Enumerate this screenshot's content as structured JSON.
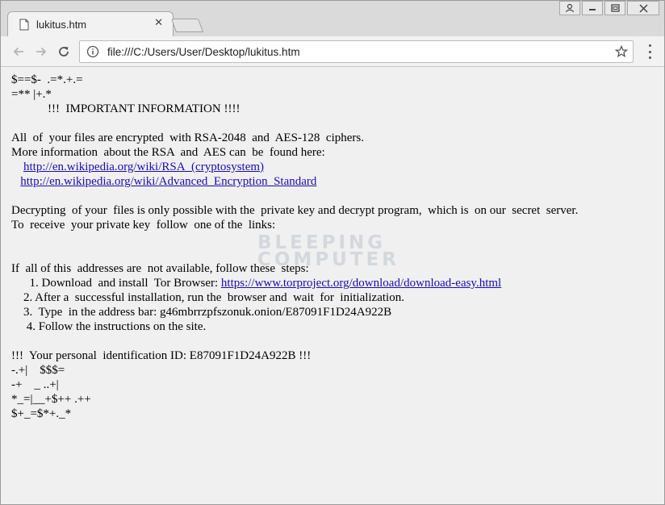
{
  "browser": {
    "tab_title": "lukitus.htm",
    "tab_close": "✕",
    "url": "file:///C:/Users/User/Desktop/lukitus.htm"
  },
  "page": {
    "lines": {
      "l1": "$==$-  .=*.+.=",
      "l2": "=** |+.*",
      "l3": "            !!!  IMPORTANT INFORMATION !!!!",
      "l4": "All  of  your files are encrypted  with RSA-2048  and  AES-128  ciphers.",
      "l5": "More information  about the RSA  and  AES can  be  found here:",
      "l6_pre": "    ",
      "l6_link": "http://en.wikipedia.org/wiki/RSA_(cryptosystem)",
      "l7_pre": "   ",
      "l7_link": "http://en.wikipedia.org/wiki/Advanced_Encryption_Standard",
      "l8": "Decrypting  of your  files is only possible with the  private key and decrypt program,  which is  on our  secret  server.",
      "l9": "To  receive  your private key  follow  one of the  links:",
      "l10": "If  all of this  addresses are  not available, follow these  steps:",
      "l11_pre": "      1. Download  and install  Tor Browser: ",
      "l11_link": "https://www.torproject.org/download/download-easy.html",
      "l12": "    2. After a  successful installation, run the  browser and  wait  for  initialization.",
      "l13": "    3.  Type  in the address bar: g46mbrrzpfszonuk.onion/E87091F1D24A922B",
      "l14": "     4. Follow the instructions on the site.",
      "l15": "!!!  Your personal  identification ID: E87091F1D24A922B !!!",
      "l16": "-.+|    $$$=",
      "l17": "-+    _ ..+|",
      "l18": "*_=|__+$++ .++",
      "l19": "$+_=$*+._*"
    },
    "watermark": [
      "BLEEPING",
      "COMPUTER"
    ]
  },
  "icons": {
    "tab": "page-icon",
    "back": "back-arrow-icon",
    "forward": "forward-arrow-icon",
    "reload": "reload-icon",
    "info": "info-icon",
    "star": "star-icon",
    "menu": "menu-dots-icon",
    "profile": "profile-icon",
    "minimize": "minimize-icon",
    "restore": "restore-icon",
    "close": "close-icon"
  },
  "colors": {
    "link": "#1a0dab",
    "page_bg": "#f0f0f0",
    "chrome_bg": "#dadada"
  }
}
